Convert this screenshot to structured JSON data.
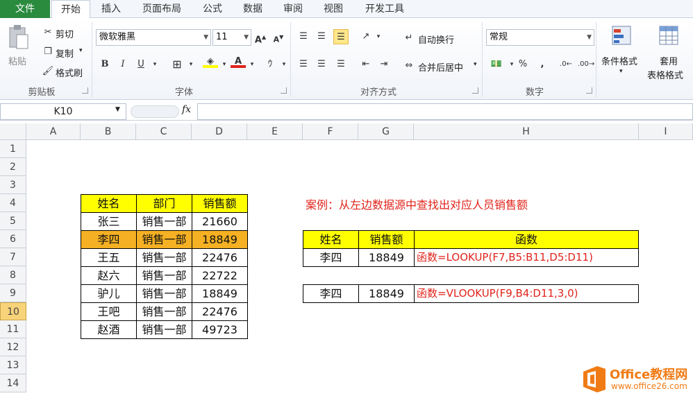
{
  "tabs": [
    "文件",
    "开始",
    "插入",
    "页面布局",
    "公式",
    "数据",
    "审阅",
    "视图",
    "开发工具"
  ],
  "ribbon": {
    "clipboard": {
      "paste": "粘贴",
      "cut": "剪切",
      "copy": "复制",
      "format_painter": "格式刷",
      "label": "剪贴板"
    },
    "font": {
      "name": "微软雅黑",
      "size": "11",
      "label": "字体",
      "bold": "B",
      "italic": "I",
      "underline": "U"
    },
    "align": {
      "wrap": "自动换行",
      "merge": "合并后居中",
      "label": "对齐方式"
    },
    "number": {
      "format": "常规",
      "percent": "%",
      "comma": ",",
      "label": "数字"
    },
    "styles": {
      "conditional": "条件格式",
      "table_format_1": "套用",
      "table_format_2": "表格格式"
    }
  },
  "formula_bar": {
    "name_box": "K10",
    "fx": "fx",
    "value": ""
  },
  "columns": [
    "A",
    "B",
    "C",
    "D",
    "E",
    "F",
    "G",
    "H",
    "I"
  ],
  "rows": [
    "1",
    "2",
    "3",
    "4",
    "5",
    "6",
    "7",
    "8",
    "9",
    "10",
    "11",
    "12",
    "13",
    "14"
  ],
  "selected_row": "10",
  "left_table": {
    "headers": [
      "姓名",
      "部门",
      "销售额"
    ],
    "rows": [
      [
        "张三",
        "销售一部",
        "21660"
      ],
      [
        "李四",
        "销售一部",
        "18849"
      ],
      [
        "王五",
        "销售一部",
        "22476"
      ],
      [
        "赵六",
        "销售一部",
        "22722"
      ],
      [
        "驴儿",
        "销售一部",
        "18849"
      ],
      [
        "王吧",
        "销售一部",
        "22476"
      ],
      [
        "赵酒",
        "销售一部",
        "49723"
      ]
    ],
    "highlight_row_index": 1
  },
  "case_title": "案例：从左边数据源中查找出对应人员销售额",
  "lookup_table": {
    "headers": [
      "姓名",
      "销售额",
      "函数"
    ],
    "row": [
      "李四",
      "18849",
      "函数=LOOKUP(F7,B5:B11,D5:D11)"
    ]
  },
  "vlookup_row": [
    "李四",
    "18849",
    "函数=VLOOKUP(F9,B4:D11,3,0)"
  ],
  "logo": {
    "brand": "Office教程网",
    "url": "www.office26.com"
  },
  "colors": {
    "header_yellow": "#ffff00",
    "highlight_orange": "#f5b123",
    "formula_red": "#e0231b",
    "file_tab": "#2a8a3e",
    "logo_orange": "#f07b15"
  }
}
